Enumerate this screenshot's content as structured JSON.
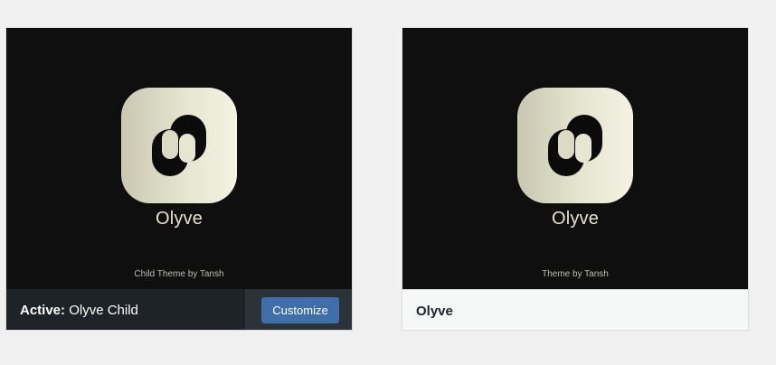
{
  "themes": [
    {
      "wordmark": "Olyve",
      "byline": "Child Theme by Tansh",
      "active_prefix": "Active:",
      "name": "Olyve Child",
      "customize_label": "Customize"
    },
    {
      "wordmark": "Olyve",
      "byline": "Theme by Tansh",
      "name": "Olyve"
    }
  ],
  "colors": {
    "screenshot_bg": "#0f0f0f",
    "active_bar": "#1d2327",
    "customize_button": "#3f6ea8",
    "logo_tile": "#e6e5d0"
  },
  "icons": {
    "logo": "olyve-logo-icon"
  }
}
